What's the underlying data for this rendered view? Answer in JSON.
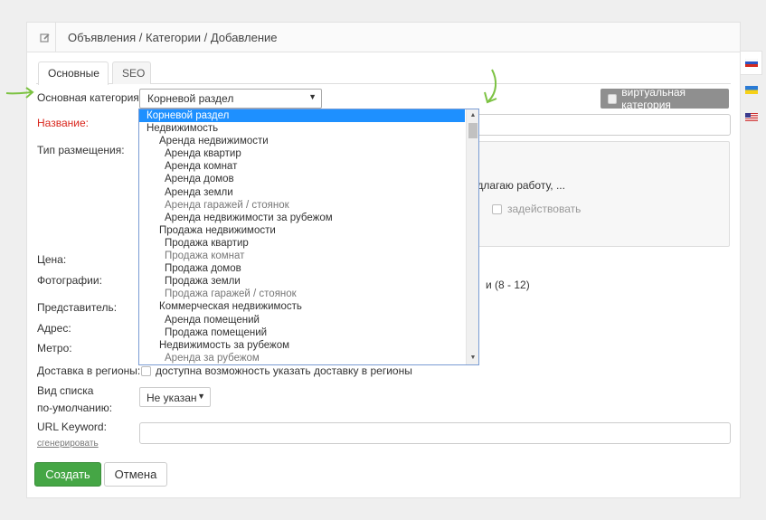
{
  "header": {
    "breadcrumb": "Объявления / Категории / Добавление",
    "icon": "edit-icon"
  },
  "tabs": [
    {
      "label": "Основные",
      "active": true
    },
    {
      "label": "SEO",
      "active": false
    }
  ],
  "form": {
    "category_label": "Основная категория:",
    "category_value": "Корневой раздел",
    "virtual_label": "виртуальная категория",
    "name_label": "Название:",
    "type_label": "Тип размещения:",
    "type_option_text": "едлагаю работу, ...",
    "type_checkbox_label": "задействовать",
    "price_label": "Цена:",
    "photos_label": "Фотографии:",
    "photos_hint": "и (8 - 12)",
    "owner_label": "Представитель:",
    "address_label": "Адрес:",
    "metro_label": "Метро:",
    "delivery_label": "Доставка в регионы:",
    "delivery_checkbox_label": "доступна возможность указать доставку в регионы",
    "list_view_label_1": "Вид списка",
    "list_view_label_2": "по-умолчанию:",
    "list_view_value": "Не указан",
    "url_label": "URL Keyword:",
    "url_generate": "сгенерировать"
  },
  "buttons": {
    "create": "Создать",
    "cancel": "Отмена"
  },
  "dropdown": {
    "items": [
      {
        "label": "Корневой раздел",
        "level": 0,
        "selected": true,
        "grey": false
      },
      {
        "label": "Недвижимость",
        "level": 0,
        "selected": false,
        "grey": false
      },
      {
        "label": "Аренда недвижимости",
        "level": 1,
        "selected": false,
        "grey": false
      },
      {
        "label": "Аренда квартир",
        "level": 2,
        "selected": false,
        "grey": false
      },
      {
        "label": "Аренда комнат",
        "level": 2,
        "selected": false,
        "grey": false
      },
      {
        "label": "Аренда домов",
        "level": 2,
        "selected": false,
        "grey": false
      },
      {
        "label": "Аренда земли",
        "level": 2,
        "selected": false,
        "grey": false
      },
      {
        "label": "Аренда гаражей / стоянок",
        "level": 2,
        "selected": false,
        "grey": true
      },
      {
        "label": "Аренда недвижимости за рубежом",
        "level": 2,
        "selected": false,
        "grey": false
      },
      {
        "label": "Продажа недвижимости",
        "level": 1,
        "selected": false,
        "grey": false
      },
      {
        "label": "Продажа квартир",
        "level": 2,
        "selected": false,
        "grey": false
      },
      {
        "label": "Продажа комнат",
        "level": 2,
        "selected": false,
        "grey": true
      },
      {
        "label": "Продажа домов",
        "level": 2,
        "selected": false,
        "grey": false
      },
      {
        "label": "Продажа земли",
        "level": 2,
        "selected": false,
        "grey": false
      },
      {
        "label": "Продажа гаражей / стоянок",
        "level": 2,
        "selected": false,
        "grey": true
      },
      {
        "label": "Коммерческая недвижимость",
        "level": 1,
        "selected": false,
        "grey": false
      },
      {
        "label": "Аренда помещений",
        "level": 2,
        "selected": false,
        "grey": false
      },
      {
        "label": "Продажа помещений",
        "level": 2,
        "selected": false,
        "grey": false
      },
      {
        "label": "Недвижимость за рубежом",
        "level": 1,
        "selected": false,
        "grey": false
      },
      {
        "label": "Аренда за рубежом",
        "level": 2,
        "selected": false,
        "grey": true
      }
    ]
  },
  "languages": [
    {
      "name": "ru-flag-icon",
      "active": true
    },
    {
      "name": "ua-flag-icon",
      "active": false
    },
    {
      "name": "us-flag-icon",
      "active": false
    }
  ],
  "colors": {
    "accent_green": "#45a645",
    "required_red": "#d9261c",
    "dropdown_highlight": "#1e90ff",
    "annotation_arrow": "#7cc242"
  }
}
